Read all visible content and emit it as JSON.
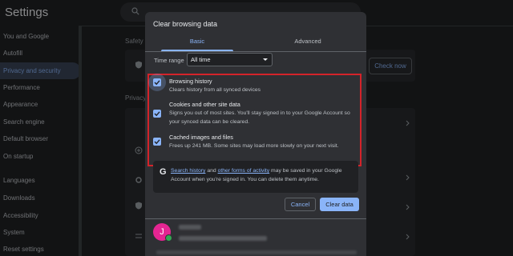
{
  "app": {
    "title": "Settings"
  },
  "sidebar": {
    "items": [
      {
        "label": "You and Google"
      },
      {
        "label": "Autofill"
      },
      {
        "label": "Privacy and security",
        "active": true
      },
      {
        "label": "Performance"
      },
      {
        "label": "Appearance"
      },
      {
        "label": "Search engine"
      },
      {
        "label": "Default browser"
      },
      {
        "label": "On startup"
      },
      {
        "label": "Languages"
      },
      {
        "label": "Downloads"
      },
      {
        "label": "Accessibility"
      },
      {
        "label": "System"
      },
      {
        "label": "Reset settings"
      }
    ]
  },
  "background": {
    "safety_label": "Safety",
    "privacy_label": "Privacy",
    "check_now_label": "Check now"
  },
  "dialog": {
    "title": "Clear browsing data",
    "tabs": {
      "basic": "Basic",
      "advanced": "Advanced"
    },
    "time_range": {
      "label": "Time range",
      "value": "All time"
    },
    "options": [
      {
        "title": "Browsing history",
        "desc": "Clears history from all synced devices",
        "checked": true
      },
      {
        "title": "Cookies and other site data",
        "desc": "Signs you out of most sites. You'll stay signed in to your Google Account so your synced data can be cleared.",
        "checked": true
      },
      {
        "title": "Cached images and files",
        "desc": "Frees up 241 MB. Some sites may load more slowly on your next visit.",
        "checked": true
      }
    ],
    "info": {
      "link1": "Search history",
      "mid": " and ",
      "link2": "other forms of activity",
      "rest": " may be saved in your Google Account when you're signed in. You can delete them anytime."
    },
    "cancel_label": "Cancel",
    "clear_label": "Clear data",
    "account": {
      "initial": "J"
    }
  },
  "colors": {
    "accent": "#8ab4f8",
    "highlight_border": "#d4232a",
    "avatar": "#e52592"
  },
  "icons": [
    "search-icon",
    "shield-icon",
    "checkbox-checked-icon",
    "google-g-icon",
    "chevron-right-icon",
    "chevron-down-icon"
  ]
}
